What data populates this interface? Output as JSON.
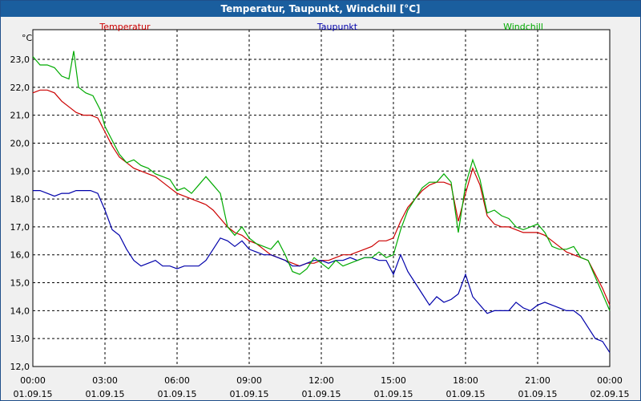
{
  "window": {
    "title": "Temperatur, Taupunkt, Windchill [°C]"
  },
  "chart_data": {
    "type": "line",
    "title": "Temperatur, Taupunkt, Windchill [°C]",
    "ylabel": "°C",
    "ylim": [
      12.0,
      23.0
    ],
    "yticks": [
      "12,0",
      "13,0",
      "14,0",
      "15,0",
      "16,0",
      "17,0",
      "18,0",
      "19,0",
      "20,0",
      "21,0",
      "22,0",
      "23,0"
    ],
    "x_range_hours": [
      0,
      24
    ],
    "xticks": [
      {
        "time": "00:00",
        "date": "01.09.15"
      },
      {
        "time": "03:00",
        "date": "01.09.15"
      },
      {
        "time": "06:00",
        "date": "01.09.15"
      },
      {
        "time": "09:00",
        "date": "01.09.15"
      },
      {
        "time": "12:00",
        "date": "01.09.15"
      },
      {
        "time": "15:00",
        "date": "01.09.15"
      },
      {
        "time": "18:00",
        "date": "01.09.15"
      },
      {
        "time": "21:00",
        "date": "01.09.15"
      },
      {
        "time": "00:00",
        "date": "02.09.15"
      }
    ],
    "grid": true,
    "series": [
      {
        "name": "Temperatur",
        "color": "#cc0000",
        "points": [
          [
            0.0,
            21.8
          ],
          [
            0.3,
            21.9
          ],
          [
            0.6,
            21.9
          ],
          [
            0.9,
            21.8
          ],
          [
            1.2,
            21.5
          ],
          [
            1.5,
            21.3
          ],
          [
            1.8,
            21.1
          ],
          [
            2.1,
            21.0
          ],
          [
            2.4,
            21.0
          ],
          [
            2.7,
            20.9
          ],
          [
            3.0,
            20.4
          ],
          [
            3.3,
            19.9
          ],
          [
            3.6,
            19.5
          ],
          [
            3.9,
            19.3
          ],
          [
            4.2,
            19.1
          ],
          [
            4.5,
            19.0
          ],
          [
            4.8,
            18.9
          ],
          [
            5.1,
            18.8
          ],
          [
            5.4,
            18.6
          ],
          [
            5.7,
            18.4
          ],
          [
            6.0,
            18.2
          ],
          [
            6.3,
            18.1
          ],
          [
            6.6,
            18.0
          ],
          [
            6.9,
            17.9
          ],
          [
            7.2,
            17.8
          ],
          [
            7.5,
            17.6
          ],
          [
            7.8,
            17.3
          ],
          [
            8.1,
            17.0
          ],
          [
            8.4,
            16.8
          ],
          [
            8.7,
            16.7
          ],
          [
            9.0,
            16.5
          ],
          [
            9.3,
            16.4
          ],
          [
            9.6,
            16.2
          ],
          [
            9.9,
            16.0
          ],
          [
            10.2,
            15.9
          ],
          [
            10.5,
            15.8
          ],
          [
            10.8,
            15.7
          ],
          [
            11.1,
            15.6
          ],
          [
            11.4,
            15.7
          ],
          [
            11.7,
            15.7
          ],
          [
            12.0,
            15.8
          ],
          [
            12.3,
            15.8
          ],
          [
            12.6,
            15.9
          ],
          [
            12.9,
            16.0
          ],
          [
            13.2,
            16.0
          ],
          [
            13.5,
            16.1
          ],
          [
            13.8,
            16.2
          ],
          [
            14.1,
            16.3
          ],
          [
            14.4,
            16.5
          ],
          [
            14.7,
            16.5
          ],
          [
            15.0,
            16.6
          ],
          [
            15.3,
            17.2
          ],
          [
            15.6,
            17.7
          ],
          [
            15.9,
            18.0
          ],
          [
            16.2,
            18.3
          ],
          [
            16.5,
            18.5
          ],
          [
            16.8,
            18.6
          ],
          [
            17.1,
            18.6
          ],
          [
            17.4,
            18.5
          ],
          [
            17.7,
            17.2
          ],
          [
            18.0,
            18.2
          ],
          [
            18.3,
            19.1
          ],
          [
            18.6,
            18.5
          ],
          [
            18.9,
            17.4
          ],
          [
            19.2,
            17.1
          ],
          [
            19.5,
            17.0
          ],
          [
            19.8,
            17.0
          ],
          [
            20.1,
            16.9
          ],
          [
            20.4,
            16.8
          ],
          [
            20.7,
            16.8
          ],
          [
            21.0,
            16.8
          ],
          [
            21.3,
            16.7
          ],
          [
            21.6,
            16.5
          ],
          [
            21.9,
            16.3
          ],
          [
            22.2,
            16.1
          ],
          [
            22.5,
            16.0
          ],
          [
            22.8,
            15.9
          ],
          [
            23.1,
            15.8
          ],
          [
            23.4,
            15.3
          ],
          [
            23.7,
            14.8
          ],
          [
            24.0,
            14.2
          ]
        ]
      },
      {
        "name": "Taupunkt",
        "color": "#0000aa",
        "points": [
          [
            0.0,
            18.3
          ],
          [
            0.3,
            18.3
          ],
          [
            0.6,
            18.2
          ],
          [
            0.9,
            18.1
          ],
          [
            1.2,
            18.2
          ],
          [
            1.5,
            18.2
          ],
          [
            1.8,
            18.3
          ],
          [
            2.1,
            18.3
          ],
          [
            2.4,
            18.3
          ],
          [
            2.7,
            18.2
          ],
          [
            3.0,
            17.6
          ],
          [
            3.3,
            16.9
          ],
          [
            3.6,
            16.7
          ],
          [
            3.9,
            16.2
          ],
          [
            4.2,
            15.8
          ],
          [
            4.5,
            15.6
          ],
          [
            4.8,
            15.7
          ],
          [
            5.1,
            15.8
          ],
          [
            5.4,
            15.6
          ],
          [
            5.7,
            15.6
          ],
          [
            6.0,
            15.5
          ],
          [
            6.3,
            15.6
          ],
          [
            6.6,
            15.6
          ],
          [
            6.9,
            15.6
          ],
          [
            7.2,
            15.8
          ],
          [
            7.5,
            16.2
          ],
          [
            7.8,
            16.6
          ],
          [
            8.1,
            16.5
          ],
          [
            8.4,
            16.3
          ],
          [
            8.7,
            16.5
          ],
          [
            9.0,
            16.2
          ],
          [
            9.3,
            16.1
          ],
          [
            9.6,
            16.0
          ],
          [
            9.9,
            16.0
          ],
          [
            10.2,
            15.9
          ],
          [
            10.5,
            15.8
          ],
          [
            10.8,
            15.6
          ],
          [
            11.1,
            15.6
          ],
          [
            11.4,
            15.7
          ],
          [
            11.7,
            15.8
          ],
          [
            12.0,
            15.8
          ],
          [
            12.3,
            15.7
          ],
          [
            12.6,
            15.8
          ],
          [
            12.9,
            15.8
          ],
          [
            13.2,
            15.9
          ],
          [
            13.5,
            15.8
          ],
          [
            13.8,
            15.9
          ],
          [
            14.1,
            15.9
          ],
          [
            14.4,
            15.8
          ],
          [
            14.7,
            15.8
          ],
          [
            15.0,
            15.3
          ],
          [
            15.3,
            16.0
          ],
          [
            15.6,
            15.4
          ],
          [
            15.9,
            15.0
          ],
          [
            16.2,
            14.6
          ],
          [
            16.5,
            14.2
          ],
          [
            16.8,
            14.5
          ],
          [
            17.1,
            14.3
          ],
          [
            17.4,
            14.4
          ],
          [
            17.7,
            14.6
          ],
          [
            18.0,
            15.3
          ],
          [
            18.3,
            14.5
          ],
          [
            18.6,
            14.2
          ],
          [
            18.9,
            13.9
          ],
          [
            19.2,
            14.0
          ],
          [
            19.5,
            14.0
          ],
          [
            19.8,
            14.0
          ],
          [
            20.1,
            14.3
          ],
          [
            20.4,
            14.1
          ],
          [
            20.7,
            14.0
          ],
          [
            21.0,
            14.2
          ],
          [
            21.3,
            14.3
          ],
          [
            21.6,
            14.2
          ],
          [
            21.9,
            14.1
          ],
          [
            22.2,
            14.0
          ],
          [
            22.5,
            14.0
          ],
          [
            22.8,
            13.8
          ],
          [
            23.1,
            13.4
          ],
          [
            23.4,
            13.0
          ],
          [
            23.7,
            12.9
          ],
          [
            24.0,
            12.5
          ]
        ]
      },
      {
        "name": "Windchill",
        "color": "#00aa00",
        "points": [
          [
            0.0,
            23.1
          ],
          [
            0.3,
            22.8
          ],
          [
            0.6,
            22.8
          ],
          [
            0.9,
            22.7
          ],
          [
            1.2,
            22.4
          ],
          [
            1.5,
            22.3
          ],
          [
            1.7,
            23.3
          ],
          [
            1.9,
            22.0
          ],
          [
            2.2,
            21.8
          ],
          [
            2.5,
            21.7
          ],
          [
            2.8,
            21.2
          ],
          [
            3.0,
            20.6
          ],
          [
            3.3,
            20.1
          ],
          [
            3.6,
            19.6
          ],
          [
            3.9,
            19.3
          ],
          [
            4.2,
            19.4
          ],
          [
            4.5,
            19.2
          ],
          [
            4.8,
            19.1
          ],
          [
            5.1,
            18.9
          ],
          [
            5.4,
            18.8
          ],
          [
            5.7,
            18.7
          ],
          [
            6.0,
            18.3
          ],
          [
            6.3,
            18.4
          ],
          [
            6.6,
            18.2
          ],
          [
            6.9,
            18.5
          ],
          [
            7.2,
            18.8
          ],
          [
            7.5,
            18.5
          ],
          [
            7.8,
            18.2
          ],
          [
            8.1,
            17.0
          ],
          [
            8.4,
            16.7
          ],
          [
            8.7,
            17.0
          ],
          [
            9.0,
            16.6
          ],
          [
            9.3,
            16.4
          ],
          [
            9.6,
            16.3
          ],
          [
            9.9,
            16.2
          ],
          [
            10.2,
            16.5
          ],
          [
            10.5,
            16.0
          ],
          [
            10.8,
            15.4
          ],
          [
            11.1,
            15.3
          ],
          [
            11.4,
            15.5
          ],
          [
            11.7,
            15.9
          ],
          [
            12.0,
            15.7
          ],
          [
            12.3,
            15.5
          ],
          [
            12.6,
            15.8
          ],
          [
            12.9,
            15.6
          ],
          [
            13.2,
            15.7
          ],
          [
            13.5,
            15.8
          ],
          [
            13.8,
            15.9
          ],
          [
            14.1,
            15.9
          ],
          [
            14.4,
            16.1
          ],
          [
            14.7,
            15.9
          ],
          [
            15.0,
            16.0
          ],
          [
            15.3,
            16.9
          ],
          [
            15.6,
            17.6
          ],
          [
            15.9,
            18.0
          ],
          [
            16.2,
            18.4
          ],
          [
            16.5,
            18.6
          ],
          [
            16.8,
            18.6
          ],
          [
            17.1,
            18.9
          ],
          [
            17.4,
            18.6
          ],
          [
            17.7,
            16.8
          ],
          [
            18.0,
            18.5
          ],
          [
            18.3,
            19.4
          ],
          [
            18.6,
            18.7
          ],
          [
            18.9,
            17.5
          ],
          [
            19.2,
            17.6
          ],
          [
            19.5,
            17.4
          ],
          [
            19.8,
            17.3
          ],
          [
            20.1,
            17.0
          ],
          [
            20.4,
            16.9
          ],
          [
            20.7,
            17.0
          ],
          [
            21.0,
            17.1
          ],
          [
            21.3,
            16.8
          ],
          [
            21.6,
            16.3
          ],
          [
            21.9,
            16.2
          ],
          [
            22.2,
            16.2
          ],
          [
            22.5,
            16.3
          ],
          [
            22.8,
            15.9
          ],
          [
            23.1,
            15.8
          ],
          [
            23.4,
            15.2
          ],
          [
            23.7,
            14.6
          ],
          [
            24.0,
            14.0
          ]
        ]
      }
    ]
  }
}
